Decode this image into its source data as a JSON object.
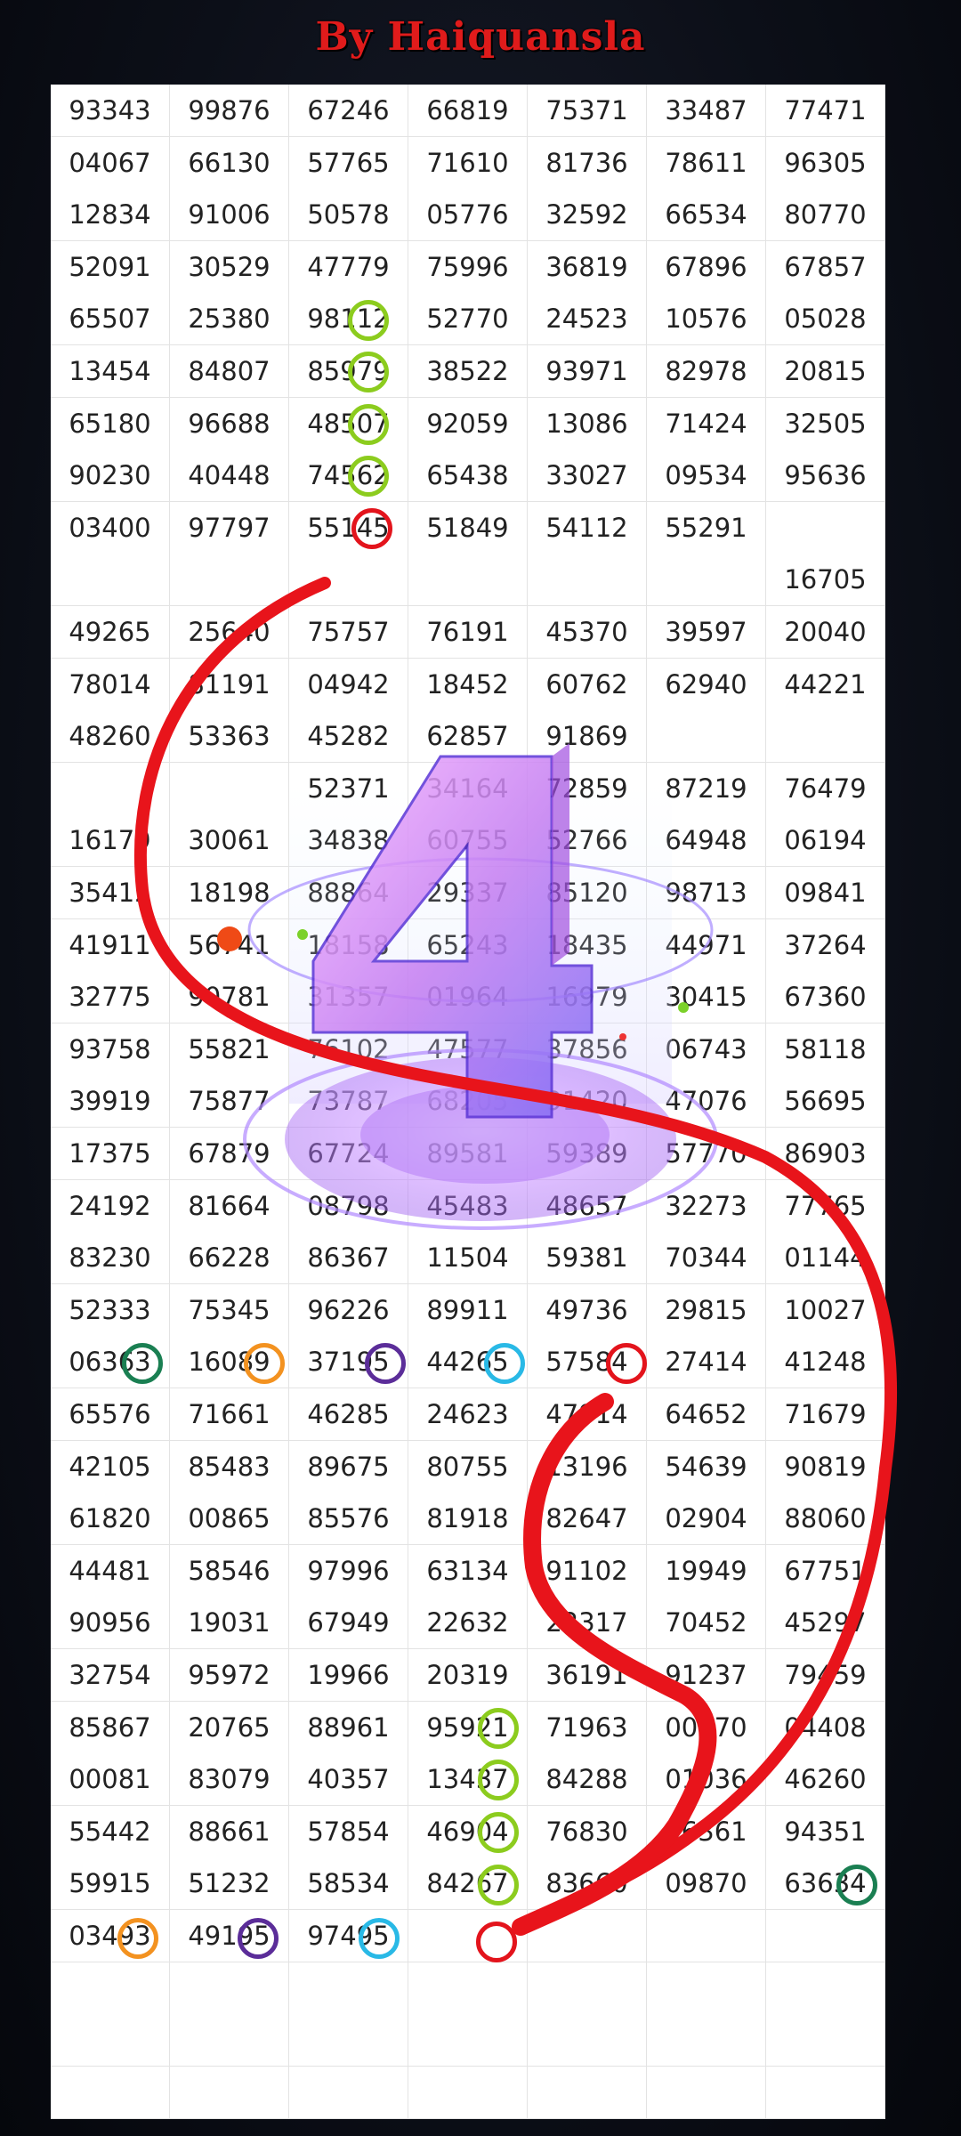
{
  "header": {
    "title": "By Haiquansla"
  },
  "table": {
    "rows": [
      [
        "93343",
        "99876",
        "67246",
        "66819",
        "75371",
        "33487",
        "77471"
      ],
      [
        "04067",
        "66130",
        "57765",
        "71610",
        "81736",
        "78611",
        "96305"
      ],
      [
        "12834",
        "91006",
        "50578",
        "05776",
        "32592",
        "66534",
        "80770"
      ],
      [
        "52091",
        "30529",
        "47779",
        "75996",
        "36819",
        "67896",
        "67857"
      ],
      [
        "65507",
        "25380",
        "98112",
        "52770",
        "24523",
        "10576",
        "05028"
      ],
      [
        "13454",
        "84807",
        "85979",
        "38522",
        "93971",
        "82978",
        "20815"
      ],
      [
        "65180",
        "96688",
        "48507",
        "92059",
        "13086",
        "71424",
        "32505"
      ],
      [
        "90230",
        "40448",
        "74562",
        "65438",
        "33027",
        "09534",
        "95636"
      ],
      [
        "03400",
        "97797",
        "55145",
        "51849",
        "54112",
        "55291",
        ""
      ],
      [
        "",
        "",
        "",
        "",
        "",
        "",
        "16705"
      ],
      [
        "49265",
        "25640",
        "75757",
        "76191",
        "45370",
        "39597",
        "20040"
      ],
      [
        "78014",
        "81191",
        "04942",
        "18452",
        "60762",
        "62940",
        "44221"
      ],
      [
        "48260",
        "53363",
        "45282",
        "62857",
        "91869",
        "",
        ""
      ],
      [
        "",
        "",
        "52371",
        "34164",
        "72859",
        "87219",
        "76479"
      ],
      [
        "16179",
        "30061",
        "34838",
        "60755",
        "52766",
        "64948",
        "06194"
      ],
      [
        "35412",
        "18198",
        "88864",
        "29337",
        "85120",
        "98713",
        "09841"
      ],
      [
        "41911",
        "56741",
        "18158",
        "65243",
        "18435",
        "44971",
        "37264"
      ],
      [
        "32775",
        "90781",
        "31357",
        "01964",
        "16979",
        "30415",
        "67360"
      ],
      [
        "93758",
        "55821",
        "76102",
        "47577",
        "37856",
        "06743",
        "58118"
      ],
      [
        "39919",
        "75877",
        "73787",
        "68205",
        "91420",
        "47076",
        "56695"
      ],
      [
        "17375",
        "67879",
        "67724",
        "89581",
        "59389",
        "57770",
        "86903"
      ],
      [
        "24192",
        "81664",
        "08798",
        "45483",
        "48657",
        "32273",
        "77765"
      ],
      [
        "83230",
        "66228",
        "86367",
        "11504",
        "59381",
        "70344",
        "01144"
      ],
      [
        "52333",
        "75345",
        "96226",
        "89911",
        "49736",
        "29815",
        "10027"
      ],
      [
        "06363",
        "16089",
        "37195",
        "44265",
        "57584",
        "27414",
        "41248"
      ],
      [
        "65576",
        "71661",
        "46285",
        "24623",
        "47914",
        "64652",
        "71679"
      ],
      [
        "42105",
        "85483",
        "89675",
        "80755",
        "13196",
        "54639",
        "90819"
      ],
      [
        "61820",
        "00865",
        "85576",
        "81918",
        "82647",
        "02904",
        "88060"
      ],
      [
        "44481",
        "58546",
        "97996",
        "63134",
        "91102",
        "19949",
        "67751"
      ],
      [
        "90956",
        "19031",
        "67949",
        "22632",
        "22317",
        "70452",
        "45297"
      ],
      [
        "32754",
        "95972",
        "19966",
        "20319",
        "36191",
        "91237",
        "79459"
      ],
      [
        "85867",
        "20765",
        "88961",
        "95921",
        "71963",
        "00970",
        "04408"
      ],
      [
        "00081",
        "83079",
        "40357",
        "13437",
        "84288",
        "01036",
        "46260"
      ],
      [
        "55442",
        "88661",
        "57854",
        "46904",
        "76830",
        "96361",
        "94351"
      ],
      [
        "59915",
        "51232",
        "58534",
        "84267",
        "83660",
        "09870",
        "63634"
      ],
      [
        "03493",
        "49195",
        "97495",
        "",
        "",
        "",
        ""
      ],
      [
        "",
        "",
        "",
        "",
        "",
        "",
        ""
      ],
      [
        "",
        "",
        "",
        "",
        "",
        "",
        ""
      ],
      [
        "",
        "",
        "",
        "",
        "",
        "",
        ""
      ]
    ]
  },
  "colors": {
    "title_red": "#e01b1b",
    "stroke_red": "#e8141b",
    "lime": "#8ccc1e",
    "orange": "#f39220",
    "purple": "#5b2d99",
    "cyan": "#29b9e6",
    "green": "#1a7f52",
    "red_circle": "#e3141c"
  },
  "overlay": {
    "figure_glyph": "4"
  }
}
